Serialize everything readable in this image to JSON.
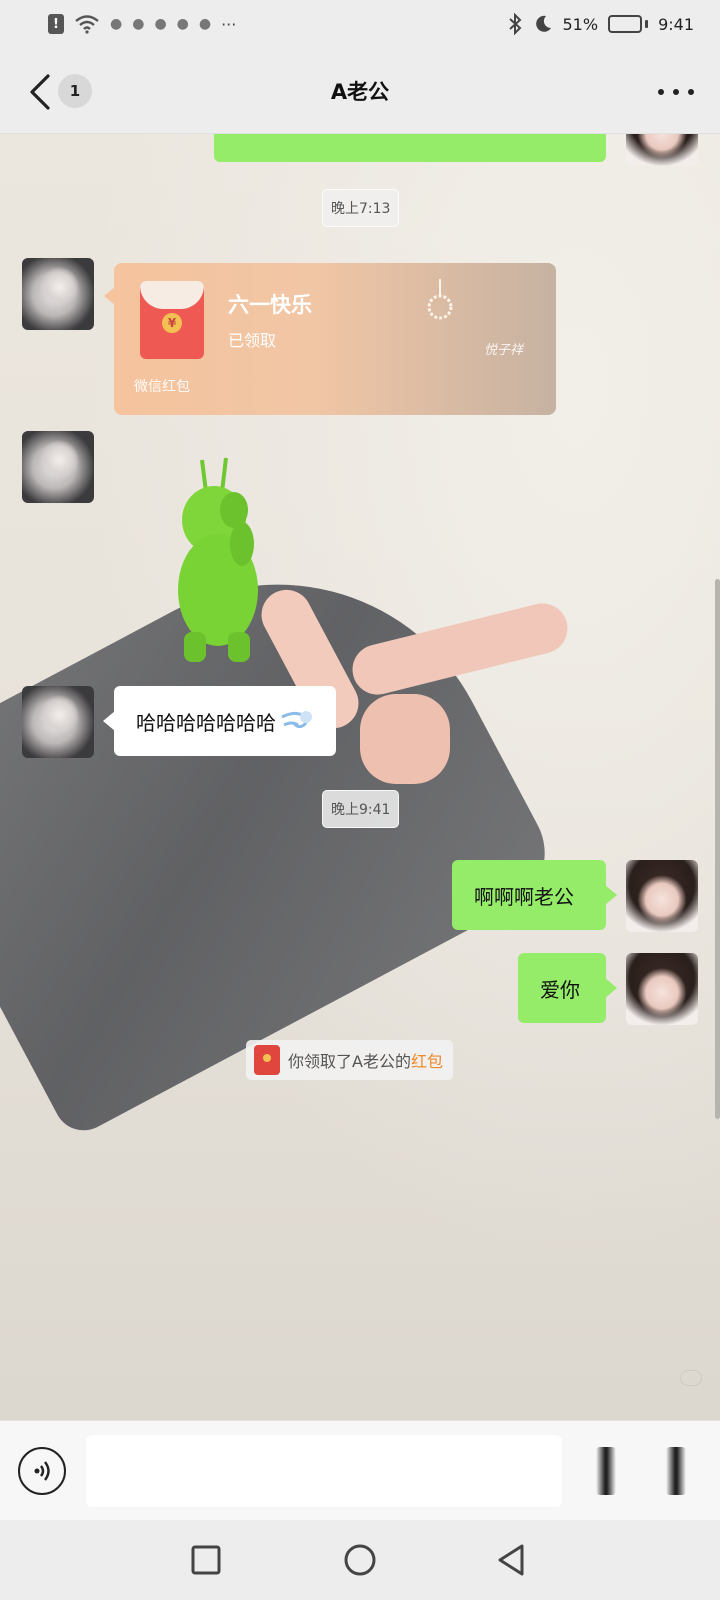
{
  "status_bar": {
    "battery": "51%",
    "battery_level": 0.51,
    "time": "9:41",
    "overflow": "···"
  },
  "header": {
    "unread_count": "1",
    "title": "A老公"
  },
  "timestamps": [
    "晚上7:13",
    "晚上9:41"
  ],
  "red_packet": {
    "title": "六一快乐",
    "status": "已领取",
    "footer": "微信红包",
    "signature": "悦子祥",
    "coin_char": "¥",
    "color": "#f5c39d"
  },
  "messages": {
    "incoming_text": "哈哈哈哈哈哈哈",
    "outgoing_1": "啊啊啊老公",
    "outgoing_2": "爱你"
  },
  "system_notice": {
    "prefix": "你领取了A老公的",
    "highlight": "红包"
  },
  "colors": {
    "bubble_out": "#95ec69",
    "bubble_in": "#ffffff",
    "notice_highlight": "#ee8a2d",
    "red_envelope": "#ee5a53"
  },
  "input": {
    "value": "",
    "placeholder": ""
  }
}
